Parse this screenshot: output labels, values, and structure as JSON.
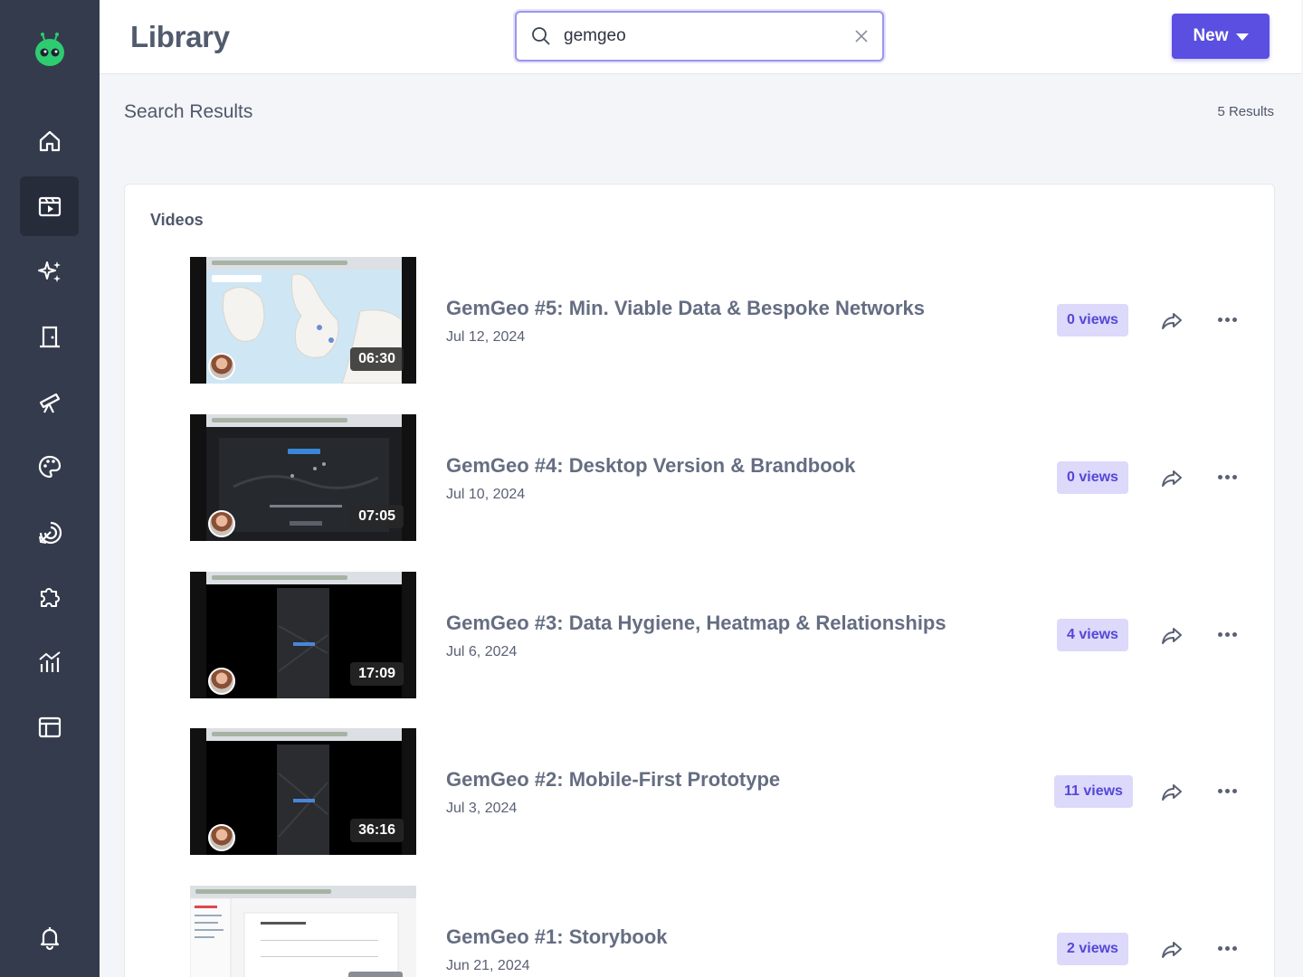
{
  "header": {
    "title": "Library",
    "search": {
      "value": "gemgeo",
      "placeholder": "Search"
    },
    "new_button_label": "New"
  },
  "results": {
    "heading": "Search Results",
    "count": "5 Results",
    "section_title": "Videos"
  },
  "videos": [
    {
      "title": "GemGeo #5: Min. Viable Data & Bespoke Networks",
      "date": "Jul 12, 2024",
      "duration": "06:30",
      "views": "0 views",
      "thumbnail_style": "map"
    },
    {
      "title": "GemGeo #4: Desktop Version & Brandbook",
      "date": "Jul 10, 2024",
      "duration": "07:05",
      "views": "0 views",
      "thumbnail_style": "dark-map"
    },
    {
      "title": "GemGeo #3: Data Hygiene, Heatmap & Relationships",
      "date": "Jul 6, 2024",
      "duration": "17:09",
      "views": "4 views",
      "thumbnail_style": "dark-mobile"
    },
    {
      "title": "GemGeo #2: Mobile-First Prototype",
      "date": "Jul 3, 2024",
      "duration": "36:16",
      "views": "11 views",
      "thumbnail_style": "dark-mobile"
    },
    {
      "title": "GemGeo #1: Storybook",
      "date": "Jun 21, 2024",
      "duration": "",
      "views": "2 views",
      "thumbnail_style": "document"
    }
  ],
  "sidebar": {
    "items": [
      {
        "icon": "home-icon"
      },
      {
        "icon": "video-library-icon",
        "active": true
      },
      {
        "icon": "sparkles-icon"
      },
      {
        "icon": "door-icon"
      },
      {
        "icon": "telescope-icon"
      },
      {
        "icon": "palette-icon"
      },
      {
        "icon": "target-arrow-icon"
      },
      {
        "icon": "puzzle-icon"
      },
      {
        "icon": "chart-icon"
      },
      {
        "icon": "layout-icon"
      }
    ],
    "bottom_icon": "bell-icon"
  },
  "colors": {
    "sidebar_bg": "#343b4c",
    "accent": "#5a4fe0",
    "views_badge_bg": "#dcd9fb",
    "views_badge_text": "#5547d6",
    "logo_green": "#2ecc71"
  }
}
